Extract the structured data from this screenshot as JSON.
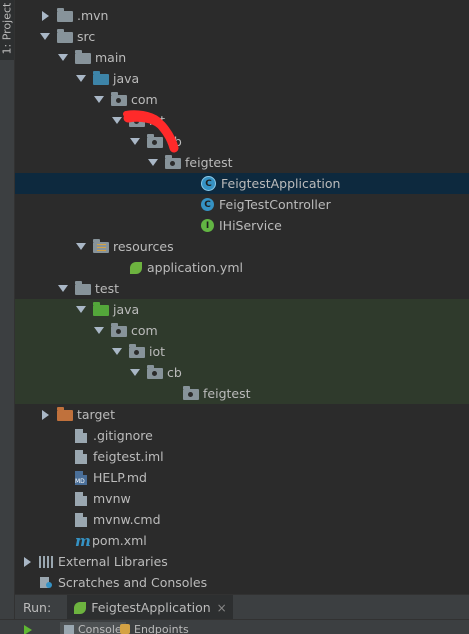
{
  "side_panel": {
    "tab_label": "1: Project"
  },
  "tree": [
    {
      "label": ".mvn",
      "icon": "folder-icon",
      "arrow": "right",
      "indent": 1
    },
    {
      "label": "src",
      "icon": "folder-icon",
      "arrow": "down",
      "indent": 1
    },
    {
      "label": "main",
      "icon": "folder-icon",
      "arrow": "down",
      "indent": 2
    },
    {
      "label": "java",
      "icon": "source-folder-icon",
      "arrow": "down",
      "indent": 3
    },
    {
      "label": "com",
      "icon": "package-icon",
      "arrow": "down",
      "indent": 4
    },
    {
      "label": "iot",
      "icon": "package-icon",
      "arrow": "down",
      "indent": 5,
      "redacted": true
    },
    {
      "label": "cb",
      "icon": "package-icon",
      "arrow": "down",
      "indent": 6,
      "redacted": true
    },
    {
      "label": "feigtest",
      "icon": "package-icon",
      "arrow": "down",
      "indent": 7
    },
    {
      "label": "FeigtestApplication",
      "icon": "spring-boot-class-icon",
      "arrow": "none",
      "indent": 9,
      "selected": true
    },
    {
      "label": "FeigTestController",
      "icon": "class-icon",
      "arrow": "none",
      "indent": 9
    },
    {
      "label": "IHiService",
      "icon": "interface-icon",
      "arrow": "none",
      "indent": 9
    },
    {
      "label": "resources",
      "icon": "resources-folder-icon",
      "arrow": "down",
      "indent": 3
    },
    {
      "label": "application.yml",
      "icon": "spring-config-icon",
      "arrow": "none",
      "indent": 5
    },
    {
      "label": "test",
      "icon": "folder-icon",
      "arrow": "down",
      "indent": 2
    },
    {
      "label": "java",
      "icon": "test-source-folder-icon",
      "arrow": "down",
      "indent": 3,
      "green": true
    },
    {
      "label": "com",
      "icon": "package-icon",
      "arrow": "down",
      "indent": 4,
      "green": true
    },
    {
      "label": "iot",
      "icon": "package-icon",
      "arrow": "down",
      "indent": 5,
      "green": true
    },
    {
      "label": "cb",
      "icon": "package-icon",
      "arrow": "down",
      "indent": 6,
      "green": true
    },
    {
      "label": "feigtest",
      "icon": "package-icon",
      "arrow": "none",
      "indent": 8,
      "green": true
    },
    {
      "label": "target",
      "icon": "excluded-folder-icon",
      "arrow": "right",
      "indent": 1
    },
    {
      "label": ".gitignore",
      "icon": "file-icon",
      "arrow": "none",
      "indent": 2
    },
    {
      "label": "feigtest.iml",
      "icon": "file-icon",
      "arrow": "none",
      "indent": 2
    },
    {
      "label": "HELP.md",
      "icon": "markdown-file-icon",
      "arrow": "none",
      "indent": 2
    },
    {
      "label": "mvnw",
      "icon": "file-icon",
      "arrow": "none",
      "indent": 2
    },
    {
      "label": "mvnw.cmd",
      "icon": "file-icon",
      "arrow": "none",
      "indent": 2
    },
    {
      "label": "pom.xml",
      "icon": "maven-icon",
      "arrow": "none",
      "indent": 2
    },
    {
      "label": "External Libraries",
      "icon": "libraries-icon",
      "arrow": "right",
      "indent": 0
    },
    {
      "label": "Scratches and Consoles",
      "icon": "scratches-icon",
      "arrow": "none",
      "indent": 0
    }
  ],
  "run_bar": {
    "label": "Run:",
    "tab": "FeigtestApplication",
    "close": "×"
  },
  "bottom_tabs": {
    "console": "Console",
    "endpoints": "Endpoints"
  },
  "colors": {
    "selection": "#0d293e",
    "test_highlight": "#2f3a2c",
    "scribble": "#ff2a2a"
  }
}
